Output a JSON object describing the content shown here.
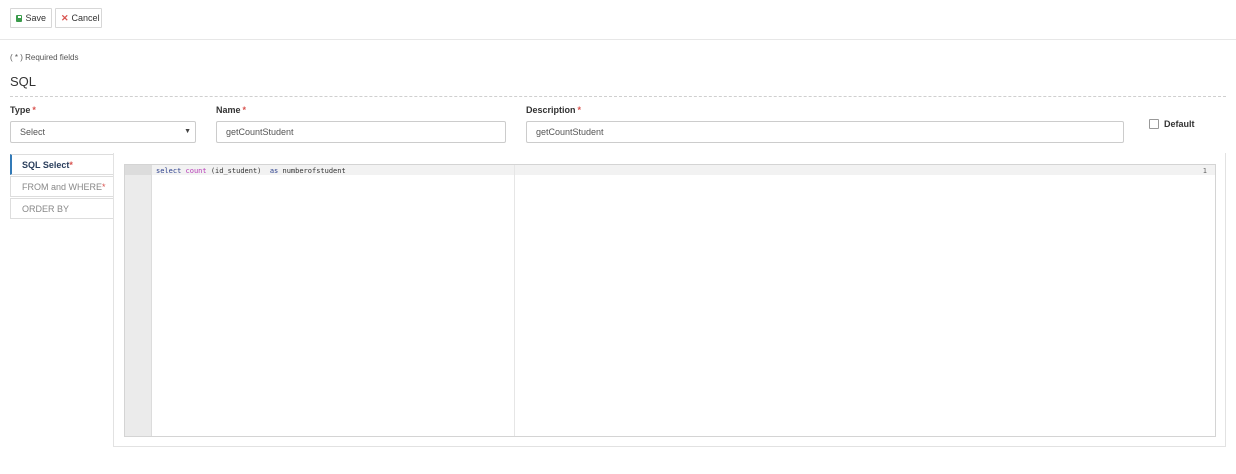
{
  "toolbar": {
    "save_label": "Save",
    "cancel_label": "Cancel"
  },
  "form": {
    "required_note": "( * ) Required fields",
    "section_title": "SQL",
    "type": {
      "label": "Type",
      "value": "Select"
    },
    "name": {
      "label": "Name",
      "value": "getCountStudent"
    },
    "description": {
      "label": "Description",
      "value": "getCountStudent"
    },
    "required_mark": "*",
    "default_label": "Default",
    "default_checked": false
  },
  "tabs": [
    {
      "label": "SQL Select",
      "required": "*",
      "active": true
    },
    {
      "label": "FROM and WHERE",
      "required": "*",
      "active": false
    },
    {
      "label": "ORDER BY",
      "required": "",
      "active": false
    }
  ],
  "editor": {
    "line_number": "1",
    "code": {
      "select_kw": "select",
      "count_fn": "count",
      "args": "(id_student)",
      "as_kw": "as",
      "alias": "numberofstudent"
    }
  },
  "colors": {
    "accent": "#337ab7",
    "required": "#d9534f",
    "save_icon": "#3a9b4b"
  }
}
